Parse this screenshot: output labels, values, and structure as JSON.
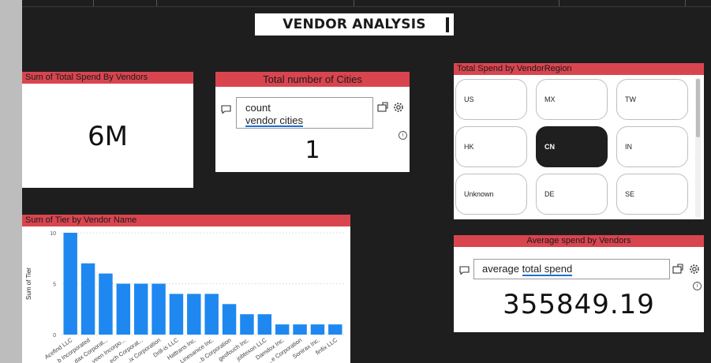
{
  "page": {
    "title": "VENDOR ANALYSIS"
  },
  "total_spend_card": {
    "header": "Sum of Total Spend By Vendors",
    "value": "6M"
  },
  "cities_card": {
    "header": "Total number of Cities",
    "query_line1": "count",
    "query_line2": "vendor cities",
    "value": "1"
  },
  "region_slicer": {
    "header": "Total Spend by VendorRegion",
    "items": [
      {
        "label": "US",
        "selected": false
      },
      {
        "label": "MX",
        "selected": false
      },
      {
        "label": "TW",
        "selected": false
      },
      {
        "label": "HK",
        "selected": false
      },
      {
        "label": "CN",
        "selected": true
      },
      {
        "label": "IN",
        "selected": false
      },
      {
        "label": "Unknown",
        "selected": false
      },
      {
        "label": "DE",
        "selected": false
      },
      {
        "label": "SE",
        "selected": false
      }
    ]
  },
  "avg_card": {
    "header": "Average spend by Vendors",
    "query_prefix": "average ",
    "query_underlined": "total spend",
    "value": "355849.19"
  },
  "colors": {
    "accent_red": "#d9454f",
    "bar_blue": "#1e88f0",
    "selected": "#1f1f1f"
  },
  "chart_data": {
    "type": "bar",
    "title": "Sum of Tier by Vendor Name",
    "xlabel": "",
    "ylabel": "Sum of Tier",
    "ylim": [
      0,
      10
    ],
    "yticks": [
      0,
      5,
      10
    ],
    "categories": [
      "Acefind LLC",
      "...b Incorporated",
      "...dax Corporat...",
      "...veen Incorpo...",
      "...ech Corporat...",
      "...ix Corporation",
      "Drill-is LLC",
      "Hattrans Inc.",
      "Linesanice Inc.",
      "...b Corporation",
      "geofouch Inc.",
      "jobtexon LLC",
      "Damdox Inc.",
      "...e Corporation",
      "Sonirax Inc.",
      "finfix LLC"
    ],
    "values": [
      10,
      7,
      6,
      5,
      5,
      5,
      4,
      4,
      4,
      3,
      2,
      2,
      1,
      1,
      1,
      1
    ]
  }
}
